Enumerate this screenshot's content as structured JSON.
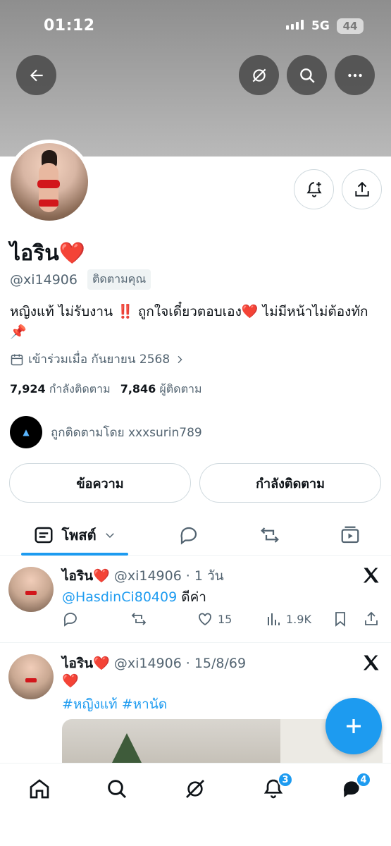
{
  "status_bar": {
    "time": "01:12",
    "network": "5G",
    "battery": "44"
  },
  "profile": {
    "name": "ไอริน❤️",
    "handle": "@xi14906",
    "follows_you": "ติดตามคุณ",
    "bio": "หญิงแท้ ไม่รับงาน ‼️ ถูกใจเดี๋ยวตอบเอง❤️ ไม่มีหน้าไม่ต้องทัก📌",
    "joined": "เข้าร่วมเมื่อ กันยายน 2568",
    "following_count": "7,924",
    "following_label": "กำลังติดตาม",
    "followers_count": "7,846",
    "followers_label": "ผู้ติดตาม",
    "followed_by": "ถูกติดตามโดย xxxsurin789"
  },
  "actions": {
    "message": "ข้อความ",
    "following": "กำลังติดตาม"
  },
  "tabs": {
    "posts": "โพสต์"
  },
  "posts": [
    {
      "name": "ไอริน❤️",
      "handle": "@xi14906",
      "time": "1 วัน",
      "mention": "@HasdinCi80409",
      "text": "ดีค่า",
      "likes": "15",
      "views": "1.9K"
    },
    {
      "name": "ไอริน❤️",
      "handle": "@xi14906",
      "time": "15/8/69",
      "text": "❤️",
      "hashtags": "#หญิงแท้ #หานัด"
    }
  ],
  "nav_badges": {
    "notifications": "3",
    "messages": "4"
  },
  "colors": {
    "accent": "#1d9bf0",
    "text": "#0f1419",
    "muted": "#536471"
  }
}
